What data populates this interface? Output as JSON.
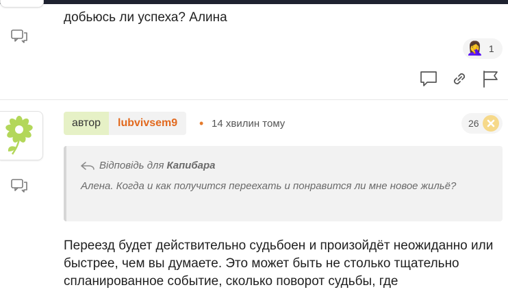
{
  "post1": {
    "text": "добьюсь ли успеха? Алина",
    "reaction": {
      "emoji": "🤦‍♀️",
      "icon": "facepalm-emoji",
      "count": "1"
    }
  },
  "post2": {
    "badge": "автор",
    "username": "lubvivsem9",
    "separator": "•",
    "time": "14 хвилин тому",
    "score": "26",
    "quote": {
      "prefix": "Відповідь для",
      "to": "Капибара",
      "text": "Алена. Когда и как получится переехать и понравится ли мне новое жильё?"
    },
    "body": "Переезд будет действительно судьбоен и произойдёт неожиданно или быстрее, чем вы думаете. Это может быть не столько тщательно спланированное событие, сколько поворот судьбы, где"
  },
  "colors": {
    "accent": "#e2691e",
    "author_badge_bg": "#e6f1c6",
    "top_bar": "#1e2230",
    "flower": "#b3d75a"
  },
  "icons": [
    "reply-icon",
    "comment-icon",
    "link-icon",
    "flag-icon",
    "reply-arrow-icon",
    "close-badge-icon",
    "flower-avatar"
  ]
}
